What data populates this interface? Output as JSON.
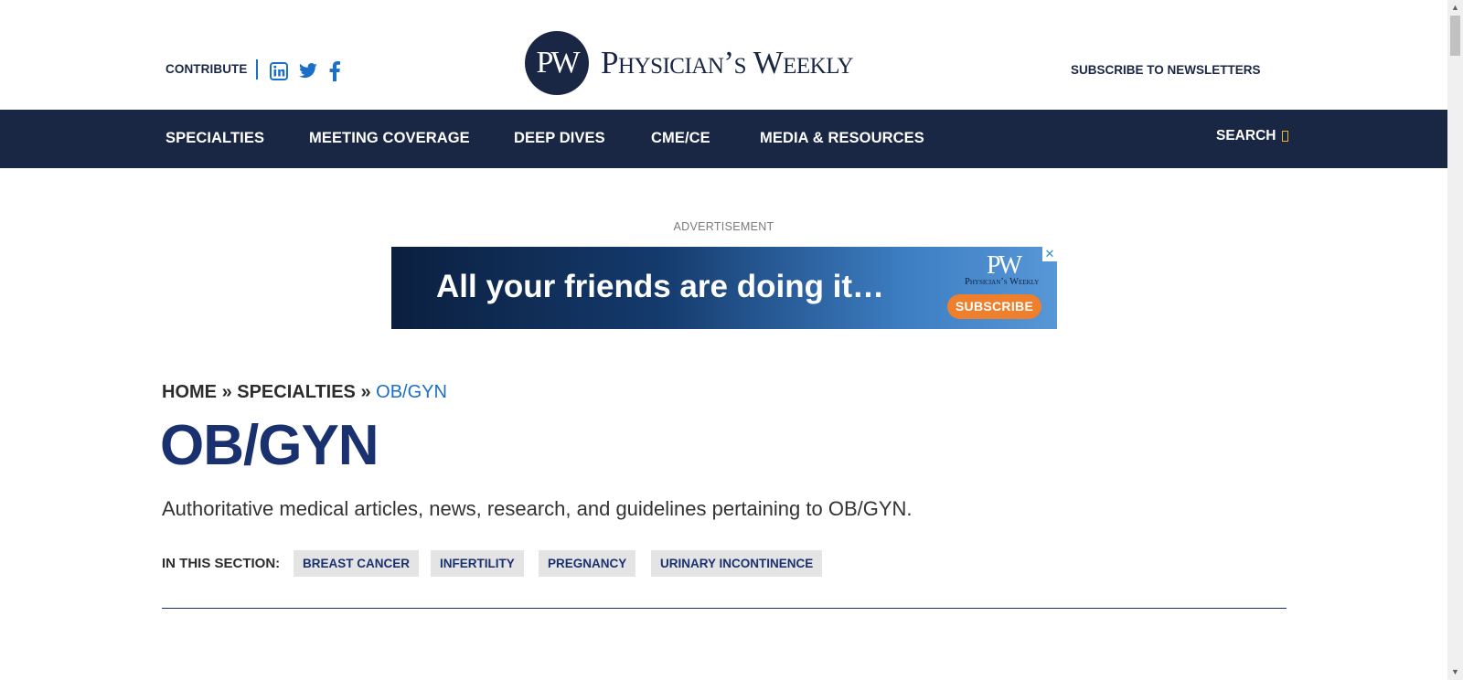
{
  "header": {
    "contribute_label": "CONTRIBUTE",
    "subscribe_label": "SUBSCRIBE TO NEWSLETTERS",
    "logo_mark": "PW",
    "logo_text": "Physician’s Weekly",
    "social_icons": [
      "linkedin-icon",
      "twitter-icon",
      "facebook-icon"
    ]
  },
  "nav": {
    "items": [
      {
        "label": "SPECIALTIES"
      },
      {
        "label": "MEETING COVERAGE"
      },
      {
        "label": "DEEP DIVES"
      },
      {
        "label": "CME/CE"
      },
      {
        "label": "MEDIA & RESOURCES"
      }
    ],
    "search_label": "SEARCH"
  },
  "ad": {
    "label": "ADVERTISEMENT",
    "headline": "All your friends are doing it…",
    "logo_mark": "PW",
    "logo_text": "Physician’s Weekly",
    "cta": "SUBSCRIBE",
    "close_glyph": "✕"
  },
  "breadcrumb": {
    "home": "HOME",
    "separator": "»",
    "specialties": "SPECIALTIES",
    "current": "OB/GYN"
  },
  "page": {
    "title": "OB/GYN",
    "description": "Authoritative medical articles, news, research, and guidelines pertaining to OB/GYN."
  },
  "section": {
    "label": "IN THIS SECTION:",
    "tags": [
      {
        "label": "BREAST CANCER"
      },
      {
        "label": "INFERTILITY"
      },
      {
        "label": "PREGNANCY"
      },
      {
        "label": "URINARY INCONTINENCE"
      }
    ]
  },
  "scrollbar": {
    "up_glyph": "▲",
    "down_glyph": "▼"
  },
  "colors": {
    "navy": "#1a2744",
    "title_blue": "#1a3170",
    "link_blue": "#1b6fc9",
    "ad_orange": "#ee7f2d",
    "search_accent": "#f3b12e",
    "tag_bg": "#e4e4e4"
  }
}
